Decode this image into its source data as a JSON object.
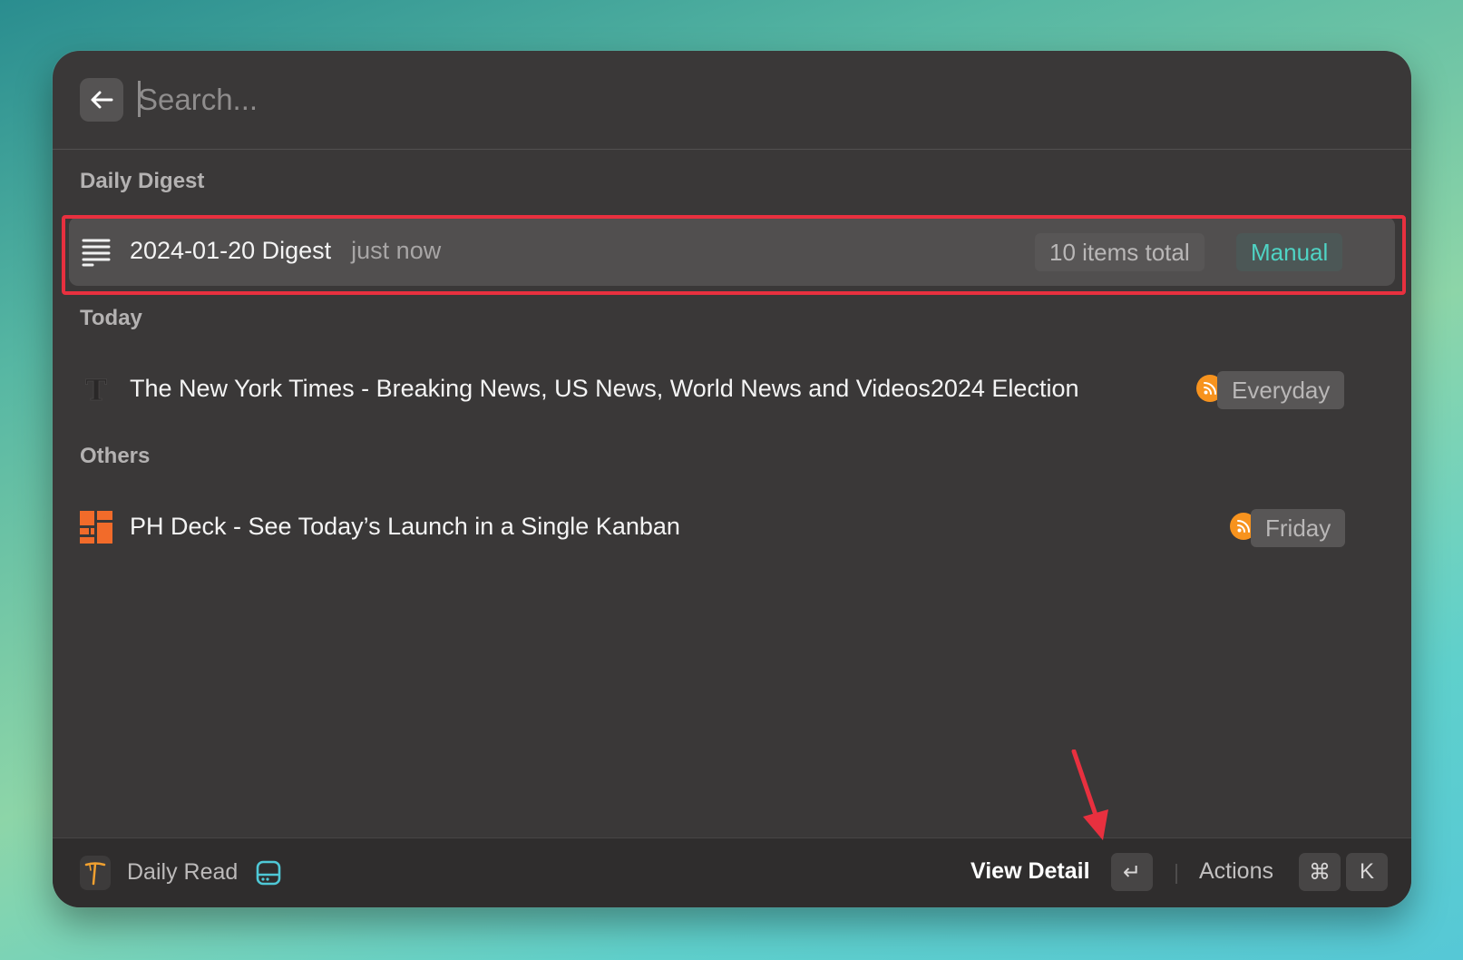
{
  "search": {
    "placeholder": "Search...",
    "value": ""
  },
  "sections": {
    "digest": {
      "title": "Daily Digest",
      "item": {
        "icon": "lines-list-icon",
        "title": "2024-01-20 Digest",
        "subtitle": "just now",
        "count_tag": "10 items total",
        "mode_tag": "Manual"
      }
    },
    "today": {
      "title": "Today",
      "item": {
        "icon": "nyt-logo-icon",
        "title": "The New York Times - Breaking News, US News, World News and Videos2024 Election",
        "feed_icon": "rss-icon",
        "schedule_tag": "Everyday"
      }
    },
    "others": {
      "title": "Others",
      "item": {
        "icon": "ph-deck-logo-icon",
        "title": "PH Deck - See Today’s Launch in a Single Kanban",
        "feed_icon": "rss-icon",
        "schedule_tag": "Friday"
      }
    }
  },
  "footer": {
    "app_name": "Daily Read",
    "primary_action": "View Detail",
    "enter_key": "↵",
    "actions_label": "Actions",
    "cmd_key": "⌘",
    "k_key": "K"
  },
  "colors": {
    "selection_highlight": "#e8303f",
    "manual_tag": "#4fd3c4",
    "rss": "#f7931e",
    "annotation_arrow": "#e8303f"
  }
}
